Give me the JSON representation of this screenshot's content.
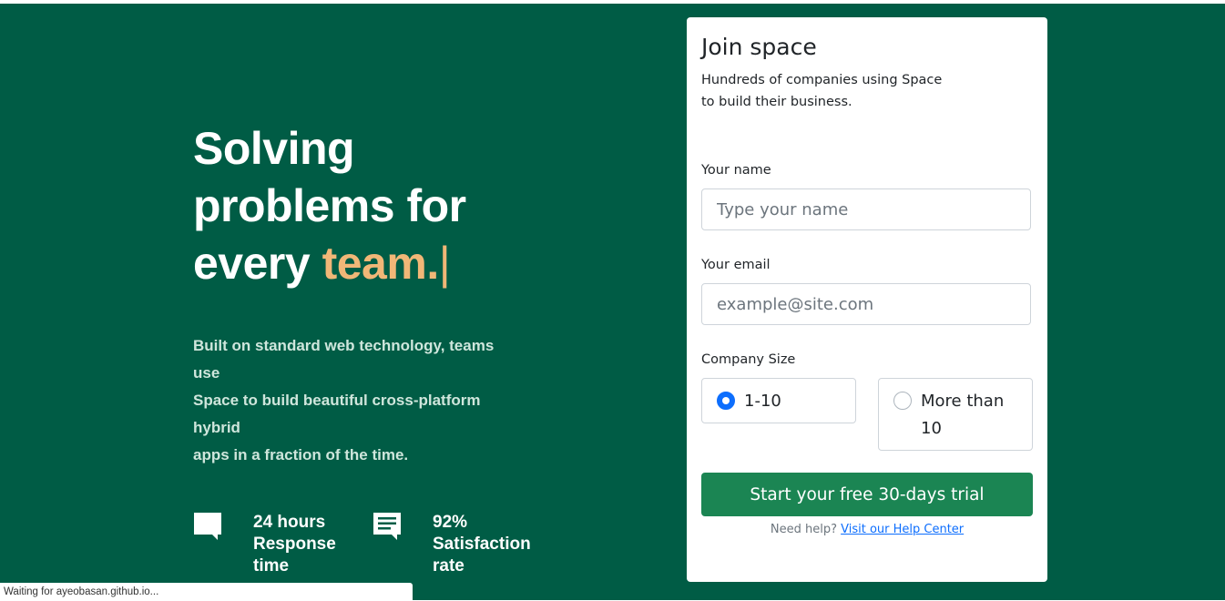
{
  "hero": {
    "headline_line1": "Solving",
    "headline_line2": "problems for",
    "headline_line3_prefix": "every ",
    "headline_accent": "team.",
    "cursor": "|",
    "description_lines": [
      "Built on standard web technology, teams",
      "use",
      "Space to build beautiful cross-platform",
      "hybrid",
      "apps in a fraction of the time."
    ],
    "stats": [
      {
        "icon": "chat-bubble-icon",
        "lines": [
          "24 hours",
          "Response",
          "time"
        ]
      },
      {
        "icon": "message-lines-icon",
        "lines": [
          "92%",
          "Satisfaction",
          "rate"
        ]
      }
    ]
  },
  "form": {
    "title": "Join space",
    "subtitle_lines": [
      "Hundreds of companies using Space",
      "to build their business."
    ],
    "name_label": "Your name",
    "name_placeholder": "Type your name",
    "email_label": "Your email",
    "email_placeholder": "example@site.com",
    "company_size_label": "Company Size",
    "options": [
      {
        "label_lines": [
          "1-10"
        ],
        "selected": true
      },
      {
        "label_lines": [
          "More than",
          "10"
        ],
        "selected": false
      }
    ],
    "submit_label": "Start your free 30-days trial",
    "help_text": "Need help? ",
    "help_link": "Visit our Help Center"
  },
  "status_bar": {
    "text": "Waiting for ayeobasan.github.io..."
  },
  "colors": {
    "background": "#005c45",
    "accent": "#f1b777",
    "button": "#1b8553",
    "radio_selected": "#0d6efd",
    "link": "#0d6efd"
  }
}
